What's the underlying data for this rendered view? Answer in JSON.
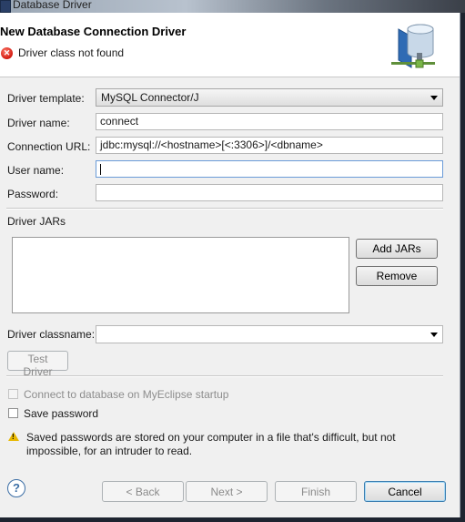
{
  "window": {
    "title": "Database Driver"
  },
  "header": {
    "title": "New Database Connection Driver",
    "error_message": "Driver class not found"
  },
  "form": {
    "driver_template": {
      "label": "Driver template:",
      "value": "MySQL Connector/J"
    },
    "driver_name": {
      "label": "Driver name:",
      "value": "connect"
    },
    "connection_url": {
      "label": "Connection URL:",
      "value": "jdbc:mysql://<hostname>[<:3306>]/<dbname>"
    },
    "user_name": {
      "label": "User name:",
      "value": ""
    },
    "password": {
      "label": "Password:",
      "value": ""
    }
  },
  "jars": {
    "label": "Driver JARs",
    "items": [],
    "add_button": "Add JARs",
    "remove_button": "Remove"
  },
  "classname": {
    "label": "Driver classname:",
    "value": ""
  },
  "test_driver_button": "Test Driver",
  "options": {
    "connect_on_startup": {
      "label": "Connect to database on MyEclipse startup",
      "checked": false,
      "enabled": false
    },
    "save_password": {
      "label": "Save password",
      "checked": false,
      "enabled": true
    }
  },
  "warning": {
    "line1": "Saved passwords are stored on your computer in a file that's difficult, but not",
    "line2": "impossible, for an intruder to read."
  },
  "footer": {
    "back": "< Back",
    "next": "Next >",
    "finish": "Finish",
    "cancel": "Cancel"
  },
  "colors": {
    "error_red": "#d21a10",
    "warning_yellow": "#e8b800",
    "focus_blue": "#6a9bd8"
  }
}
